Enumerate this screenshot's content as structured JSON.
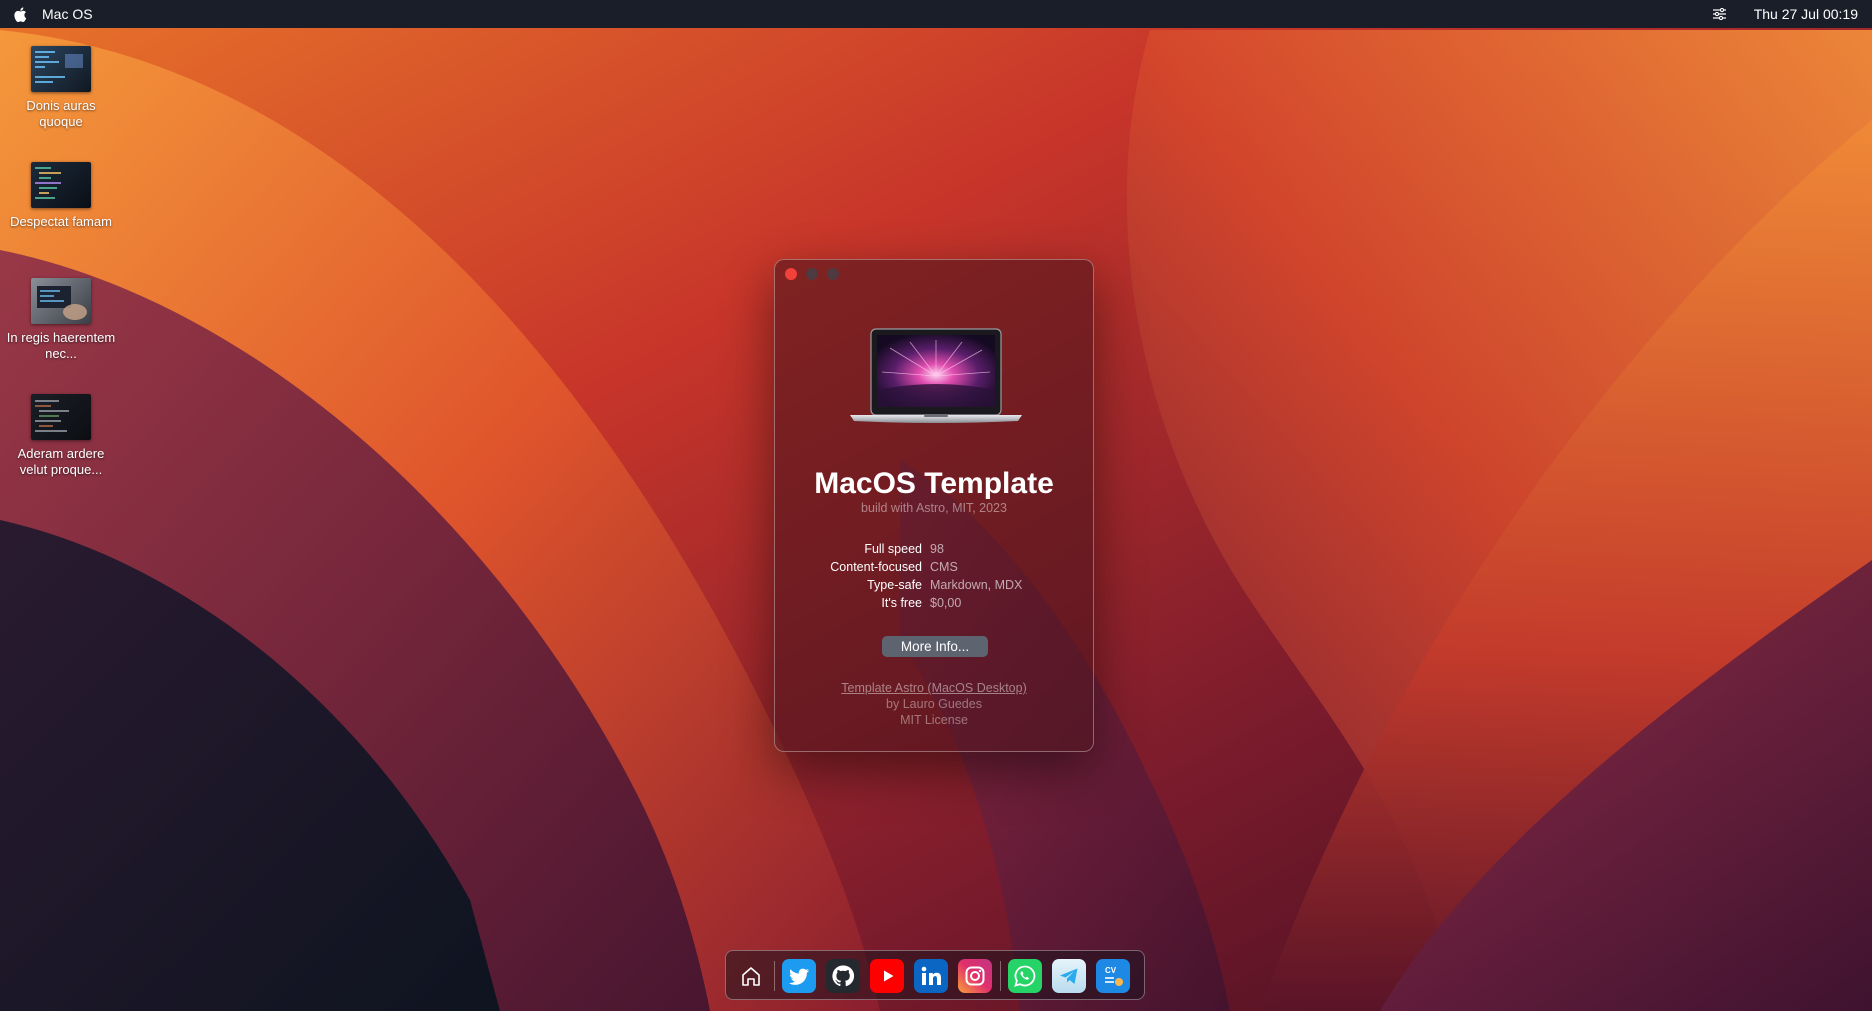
{
  "menubar": {
    "app_name": "Mac OS",
    "datetime": "Thu 27 Jul 00:19",
    "icons": [
      "apple-logo-icon",
      "control-center-icon"
    ]
  },
  "desktop_items": [
    {
      "label": "Donis auras quoque",
      "thumb_color": "#1c2a3a"
    },
    {
      "label": "Despectat famam",
      "thumb_color": "#14202e"
    },
    {
      "label": "In regis haerentem nec...",
      "thumb_color": "#4a4f58"
    },
    {
      "label": "Aderam ardere velut proque...",
      "thumb_color": "#181c22"
    }
  ],
  "about_window": {
    "title": "MacOS Template",
    "subtitle": "build with Astro, MIT, 2023",
    "specs": [
      {
        "key": "Full speed",
        "value": "98"
      },
      {
        "key": "Content-focused",
        "value": "CMS"
      },
      {
        "key": "Type-safe",
        "value": "Markdown, MDX"
      },
      {
        "key": "It's free",
        "value": "$0,00"
      }
    ],
    "button_label": "More Info...",
    "footer_link": "Template Astro (MacOS Desktop)",
    "footer_author": "by Lauro Guedes",
    "footer_license": "MIT License"
  },
  "dock": {
    "items": [
      {
        "name": "home-icon",
        "color": "#2a2a30"
      },
      {
        "name": "twitter-icon",
        "color": "#1d9bf0"
      },
      {
        "name": "github-icon",
        "color": "#24292f"
      },
      {
        "name": "youtube-icon",
        "color": "#ff0000"
      },
      {
        "name": "linkedin-icon",
        "color": "#0a66c2"
      },
      {
        "name": "instagram-icon",
        "color": "#e1306c"
      },
      {
        "name": "whatsapp-icon",
        "color": "#25d366"
      },
      {
        "name": "telegram-icon",
        "color": "#2aabee"
      },
      {
        "name": "cv-icon",
        "color": "#1e88e5"
      }
    ]
  },
  "colors": {
    "menubar_bg": "#1a1e29",
    "close_button": "#f2413a",
    "button_bg": "#5d6470"
  }
}
